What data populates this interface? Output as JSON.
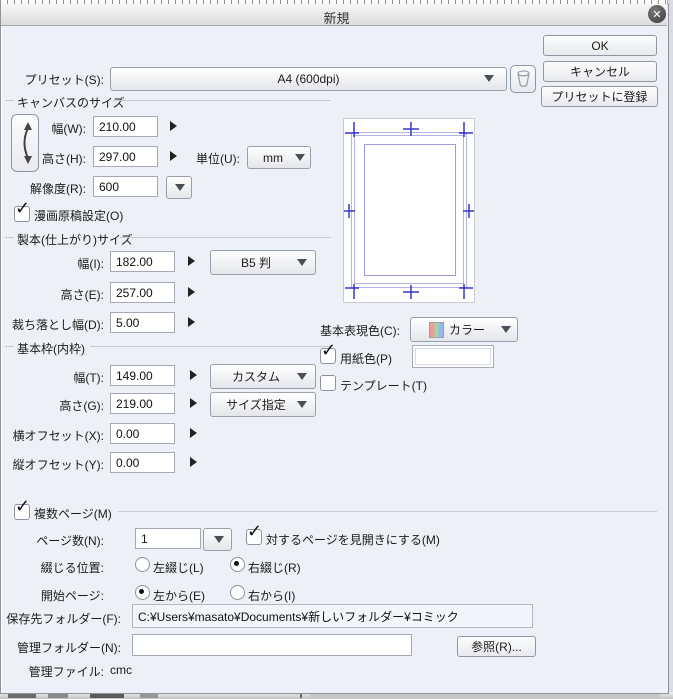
{
  "glyphs": {
    "check": "✓",
    "close": "✕"
  },
  "window": {
    "title": "新規"
  },
  "actions": {
    "ok": "OK",
    "cancel": "キャンセル",
    "register_preset": "プリセットに登録"
  },
  "preset": {
    "label": "プリセット(S):",
    "value": "A4 (600dpi)"
  },
  "canvas": {
    "section": "キャンバスのサイズ",
    "width_label": "幅(W):",
    "width": "210.00",
    "height_label": "高さ(H):",
    "height": "297.00",
    "unit_label": "単位(U):",
    "unit": "mm",
    "resolution_label": "解像度(R):",
    "resolution": "600",
    "manga_setting_label": "漫画原稿設定(O)"
  },
  "binding": {
    "section": "製本(仕上がり)サイズ",
    "width_label": "幅(I):",
    "width": "182.00",
    "size_preset": "B5 判",
    "height_label": "高さ(E):",
    "height": "257.00",
    "bleed_label": "裁ち落とし幅(D):",
    "bleed": "5.00"
  },
  "frame": {
    "section": "基本枠(内枠)",
    "width_label": "幅(T):",
    "width": "149.00",
    "width_mode": "カスタム",
    "height_label": "高さ(G):",
    "height": "219.00",
    "height_mode": "サイズ指定",
    "offset_x_label": "横オフセット(X):",
    "offset_x": "0.00",
    "offset_y_label": "縦オフセット(Y):",
    "offset_y": "0.00"
  },
  "expression": {
    "color_label": "基本表現色(C):",
    "color_value": "カラー",
    "paper_color_label": "用紙色(P)",
    "template_label": "テンプレート(T)"
  },
  "pages": {
    "section": "複数ページ(M)",
    "count_label": "ページ数(N):",
    "count": "1",
    "facing_label": "対するページを見開きにする(M)",
    "binding_pos_label": "綴じる位置:",
    "bind_left": "左綴じ(L)",
    "bind_right": "右綴じ(R)",
    "start_label": "開始ページ:",
    "start_left": "左から(E)",
    "start_right": "右から(I)"
  },
  "storage": {
    "save_folder_label": "保存先フォルダー(F):",
    "save_folder": "C:¥Users¥masato¥Documents¥新しいフォルダー¥コミック",
    "mgmt_folder_label": "管理フォルダー(N):",
    "mgmt_folder": "",
    "browse": "参照(R)...",
    "mgmt_file_label": "管理ファイル:",
    "mgmt_file": "cmc"
  },
  "colors": {
    "guide_accent": "#3535cf",
    "guide_frame": "#a9a9e2",
    "swatch_pink": "#f09a9a",
    "swatch_green": "#9fd89f",
    "swatch_blue": "#97b6f0",
    "paper_color": "#ffffff"
  }
}
